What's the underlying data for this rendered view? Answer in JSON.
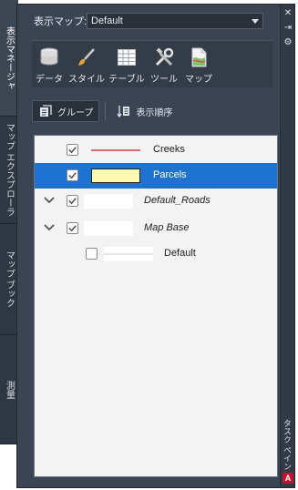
{
  "left_tabs": [
    {
      "label": "表示マネージャ",
      "active": true
    },
    {
      "label": "マップ エクスプローラ",
      "active": false
    },
    {
      "label": "マップ ブック",
      "active": false
    },
    {
      "label": "測量",
      "active": false
    }
  ],
  "header": {
    "map_label": "表示マップ:",
    "map_value": "Default"
  },
  "toolbar": {
    "data_label": "データ",
    "style_label": "スタイル",
    "table_label": "テーブル",
    "tools_label": "ツール",
    "map_label": "マップ"
  },
  "view_modes": {
    "group_label": "グループ",
    "order_label": "表示順序"
  },
  "layers": [
    {
      "name": "Creeks",
      "checked": true,
      "selected": false,
      "italic": false,
      "swatch": "line",
      "color": "#c0202a"
    },
    {
      "name": "Parcels",
      "checked": true,
      "selected": true,
      "italic": false,
      "swatch": "fill",
      "color": "#fff9b0"
    },
    {
      "name": "Default_Roads",
      "checked": true,
      "selected": false,
      "italic": true,
      "expandable": true
    },
    {
      "name": "Map Base",
      "checked": true,
      "selected": false,
      "italic": true,
      "expandable": true
    },
    {
      "name": "Default",
      "checked": false,
      "selected": false,
      "italic": false,
      "swatch": "line",
      "color": "#cccccc"
    }
  ],
  "side_panel": {
    "task_label": "タスク ペイン"
  },
  "colors": {
    "panel_bg": "#3b4453",
    "selection": "#1e73d0",
    "list_bg": "#f3f3f3"
  }
}
